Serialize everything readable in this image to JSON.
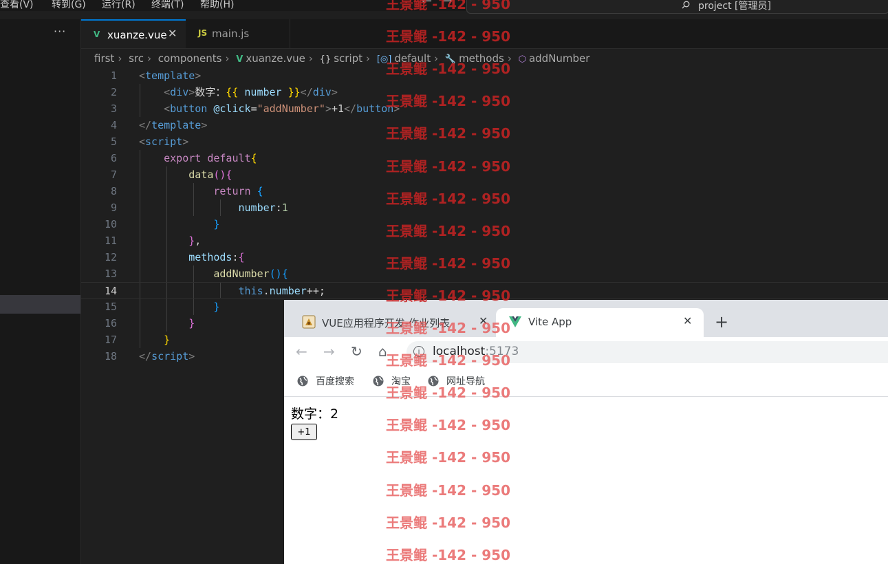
{
  "menu": [
    "查看(V)",
    "转到(G)",
    "运行(R)",
    "终端(T)",
    "帮助(H)"
  ],
  "command_center": {
    "title": "project [管理员]",
    "search_icon": "search-icon",
    "back_icon": "arrow-left-icon",
    "forward_icon": "arrow-right-icon"
  },
  "sidebar": {
    "more_icon": "more-icon",
    "more_label": "···"
  },
  "editor_tabs": [
    {
      "label": "xuanze.vue",
      "icon": "vue-icon",
      "icon_label": "V",
      "active": true,
      "close": "✕"
    },
    {
      "label": "main.js",
      "icon": "js-icon",
      "icon_label": "JS",
      "active": false
    }
  ],
  "breadcrumb": [
    {
      "label": "first"
    },
    {
      "label": "src"
    },
    {
      "label": "components"
    },
    {
      "label": "xuanze.vue",
      "icon": "vue-icon",
      "icon_label": "V"
    },
    {
      "label": "script",
      "icon": "braces-icon",
      "icon_label": "{}"
    },
    {
      "label": "default",
      "icon": "module-icon",
      "icon_label": "[◎]"
    },
    {
      "label": "methods",
      "icon": "wrench-icon",
      "icon_label": "🔧"
    },
    {
      "label": "addNumber",
      "icon": "cube-icon",
      "icon_label": "⬡"
    }
  ],
  "code": {
    "current_line": 14,
    "lines": [
      {
        "n": "1",
        "tokens": [
          [
            "<",
            "t-br"
          ],
          [
            "template",
            "t-tag"
          ],
          [
            ">",
            "t-br"
          ]
        ]
      },
      {
        "n": "2",
        "tokens": [
          [
            "    ",
            ""
          ],
          [
            "<",
            "t-br"
          ],
          [
            "div",
            "t-tag"
          ],
          [
            ">",
            "t-br"
          ],
          [
            "数字：",
            "t-txt"
          ],
          [
            "{{ ",
            "b1"
          ],
          [
            "number",
            "t-prop"
          ],
          [
            " }}",
            "b1"
          ],
          [
            "</",
            "t-br"
          ],
          [
            "div",
            "t-tag"
          ],
          [
            ">",
            "t-br"
          ]
        ]
      },
      {
        "n": "3",
        "tokens": [
          [
            "    ",
            ""
          ],
          [
            "<",
            "t-br"
          ],
          [
            "button",
            "t-tag"
          ],
          [
            " @click",
            "t-attr"
          ],
          [
            "=",
            "t-txt"
          ],
          [
            "\"addNumber\"",
            "t-str"
          ],
          [
            ">",
            "t-br"
          ],
          [
            "+1",
            "t-txt"
          ],
          [
            "</",
            "t-br"
          ],
          [
            "button",
            "t-tag"
          ],
          [
            ">",
            "t-br"
          ]
        ]
      },
      {
        "n": "4",
        "tokens": [
          [
            "</",
            "t-br"
          ],
          [
            "template",
            "t-tag"
          ],
          [
            ">",
            "t-br"
          ]
        ]
      },
      {
        "n": "5",
        "tokens": [
          [
            "<",
            "t-br"
          ],
          [
            "script",
            "t-tag"
          ],
          [
            ">",
            "t-br"
          ]
        ]
      },
      {
        "n": "6",
        "tokens": [
          [
            "    ",
            ""
          ],
          [
            "export",
            "t-kw"
          ],
          [
            " ",
            ""
          ],
          [
            "default",
            "t-kw"
          ],
          [
            "{",
            "b1"
          ]
        ]
      },
      {
        "n": "7",
        "tokens": [
          [
            "        ",
            ""
          ],
          [
            "data",
            "t-fn"
          ],
          [
            "(){",
            "b2"
          ]
        ]
      },
      {
        "n": "8",
        "tokens": [
          [
            "            ",
            ""
          ],
          [
            "return",
            "t-kw"
          ],
          [
            " ",
            ""
          ],
          [
            "{",
            "b3"
          ]
        ]
      },
      {
        "n": "9",
        "tokens": [
          [
            "                ",
            ""
          ],
          [
            "number",
            "t-prop"
          ],
          [
            ":",
            "t-txt"
          ],
          [
            "1",
            "t-num"
          ]
        ]
      },
      {
        "n": "10",
        "tokens": [
          [
            "            ",
            ""
          ],
          [
            "}",
            "b3"
          ]
        ]
      },
      {
        "n": "11",
        "tokens": [
          [
            "        ",
            ""
          ],
          [
            "}",
            "b2"
          ],
          [
            ",",
            "t-txt"
          ]
        ]
      },
      {
        "n": "12",
        "tokens": [
          [
            "        ",
            ""
          ],
          [
            "methods",
            "t-prop"
          ],
          [
            ":",
            "t-txt"
          ],
          [
            "{",
            "b2"
          ]
        ]
      },
      {
        "n": "13",
        "tokens": [
          [
            "            ",
            ""
          ],
          [
            "addNumber",
            "t-fn"
          ],
          [
            "(){",
            "b3"
          ]
        ]
      },
      {
        "n": "14",
        "tokens": [
          [
            "                ",
            ""
          ],
          [
            "this",
            "t-kw2"
          ],
          [
            ".",
            "t-txt"
          ],
          [
            "number",
            "t-prop"
          ],
          [
            "++;",
            "t-txt"
          ]
        ]
      },
      {
        "n": "15",
        "tokens": [
          [
            "            ",
            ""
          ],
          [
            "}",
            "b3"
          ]
        ]
      },
      {
        "n": "16",
        "tokens": [
          [
            "        ",
            ""
          ],
          [
            "}",
            "b2"
          ]
        ]
      },
      {
        "n": "17",
        "tokens": [
          [
            "    ",
            ""
          ],
          [
            "}",
            "b1"
          ]
        ]
      },
      {
        "n": "18",
        "tokens": [
          [
            "</",
            "t-br"
          ],
          [
            "script",
            "t-tag"
          ],
          [
            ">",
            "t-br"
          ]
        ]
      }
    ]
  },
  "browser": {
    "tabs": [
      {
        "label": "VUE应用程序开发-作业列表",
        "icon": "flask-favicon-icon",
        "active": false,
        "close": "✕"
      },
      {
        "label": "Vite App",
        "icon": "vue-favicon-icon",
        "active": true,
        "close": "✕"
      }
    ],
    "new_tab": "+",
    "nav": {
      "back": "←",
      "forward": "→",
      "reload": "↻",
      "home": "⌂",
      "info": "i"
    },
    "address": {
      "host": "localhost",
      "port": ":5173"
    },
    "bookmarks": [
      "百度搜索",
      "淘宝",
      "网址导航"
    ],
    "content": {
      "number_label": "数字：2",
      "button_label": "+1"
    }
  },
  "watermark": {
    "text": "王景鲲 -142 - 950"
  }
}
